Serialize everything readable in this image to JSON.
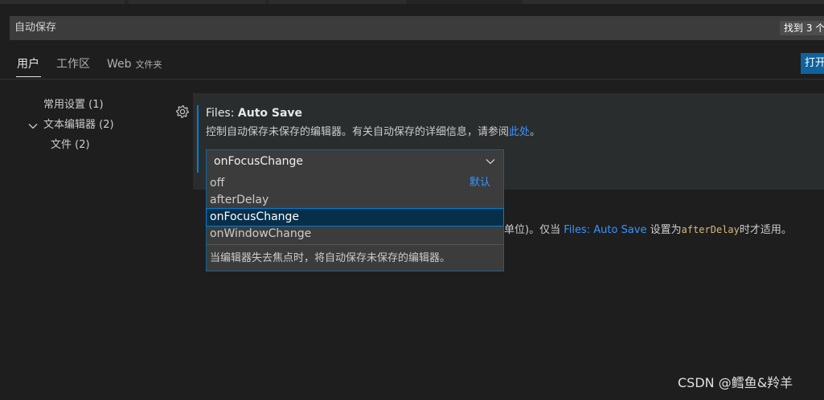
{
  "search": {
    "value": "自动保存",
    "result_badge": "找到 3 个"
  },
  "tabs": [
    {
      "label": "用户",
      "active": true
    },
    {
      "label": "工作区",
      "active": false
    },
    {
      "label": "Web",
      "sub": "文件夹",
      "active": false
    }
  ],
  "open_json_label": "打开",
  "tree": [
    {
      "label": "常用设置 (1)"
    },
    {
      "label": "文本编辑器 (2)",
      "expanded": true
    },
    {
      "label": "文件 (2)"
    }
  ],
  "setting": {
    "category": "Files: ",
    "name": "Auto Save",
    "description_prefix": "控制自动保存未保存的编辑器。有关自动保存的详细信息，请参阅",
    "description_link": "此处",
    "description_suffix": "。",
    "current_value": "onFocusChange"
  },
  "dropdown": {
    "options": [
      "off",
      "afterDelay",
      "onFocusChange",
      "onWindowChange"
    ],
    "selected": "onFocusChange",
    "default_label": "默认",
    "option_description": "当编辑器失去焦点时，将自动保存未保存的编辑器。"
  },
  "background_setting": {
    "text_before": "单位)。仅当 ",
    "link": "Files: Auto Save",
    "text_mid": " 设置为",
    "code": "afterDelay",
    "text_after": "时才适用。"
  },
  "watermark": "CSDN @鳕鱼&羚羊",
  "colors": {
    "background": "#1e1e1e",
    "accent": "#007fd4",
    "link": "#3794ff",
    "button": "#0e639c"
  }
}
